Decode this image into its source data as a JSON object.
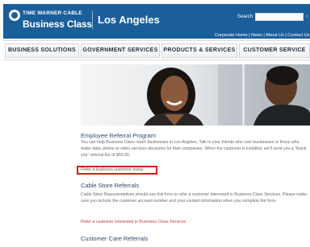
{
  "header": {
    "brand_small": "TIME WARNER CABLE",
    "brand_big": "Business Class",
    "city": "Los Angeles",
    "search_label": "Search",
    "search_go": "›",
    "utility_links": "Corporate Home  |  News  |  About Us  |  Contact Us",
    "brand_color": "#1a5f9a"
  },
  "nav": {
    "tabs": [
      {
        "label": "BUSINESS SOLUTIONS"
      },
      {
        "label": "GOVERNMENT SERVICES"
      },
      {
        "label": "PRODUCTS & SERVICES"
      },
      {
        "label": "CUSTOMER SERVICE"
      }
    ]
  },
  "sections": {
    "employee": {
      "title": "Employee Referral Program",
      "body": "You can help Business Class reach businesses in Los Angeles. Talk to your friends who own businesses or those who make data, phone or video services decisions for their companies. When the customer is installed, we'll send you a \"thank you\" referral fee of $50.00.",
      "link": "Refer a business customer today"
    },
    "cable_store": {
      "title": "Cable Store Referrals",
      "body": "Cable Store Representatives should use this form to refer a customer interested in Business Class Services. Please make sure you include the customer account number and your contact information when you complete the form.",
      "link": "Refer a customer interested in Business Class Services"
    },
    "customer_care": {
      "title": "Customer Care Referrals"
    }
  },
  "colors": {
    "link": "#c2403a",
    "highlight": "#d11f1f",
    "heading": "#2b4c70"
  }
}
